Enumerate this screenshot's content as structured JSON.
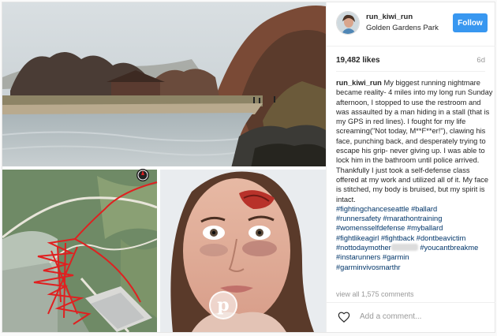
{
  "profile": {
    "username": "run_kiwi_run",
    "location": "Golden Gardens Park",
    "follow_label": "Follow"
  },
  "post": {
    "likes": "19,482 likes",
    "time_ago": "6d",
    "caption_user": "run_kiwi_run",
    "caption_text": "My biggest running nightmare became reality- 4 miles into my long run Sunday afternoon, I stopped to use the restroom and was assaulted by a man hiding in a stall (that is my GPS in red lines). I fought for my life screaming(\"Not today, M**F**er!\"), clawing his face, punching back, and desperately trying to escape his grip- never giving up. I was able to lock him in the bathroom until police arrived. Thankfully I just took a self-defense class offered at my work and utilized all of it. My face is stitched, my body is bruised, but my spirit is intact.",
    "hashtags": [
      "#fightingchanceseattle #ballard",
      "#runnersafety #marathontraining",
      "#womensselfdefense #myballard",
      "#fightlikeagirl #fightback #dontbeavictim",
      "#nottodaymother",
      " #youcantbreakme",
      "#instarunners #garmin",
      "#garminvivosmarthr"
    ],
    "view_all_comments": "view all 1,575 comments",
    "comment_placeholder": "Add a comment..."
  },
  "icons": {
    "heart": "heart-icon",
    "pinterest": "pinterest-icon",
    "compass": "compass-icon"
  },
  "colors": {
    "follow_button": "#3897f0",
    "hashtag": "#003569",
    "gps_route": "#e02020"
  }
}
